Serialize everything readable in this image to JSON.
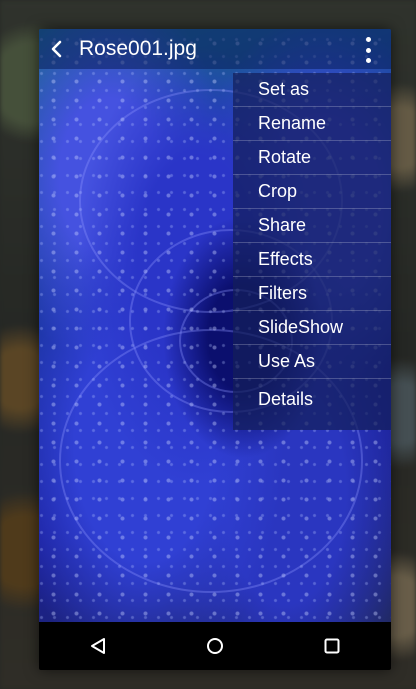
{
  "header": {
    "title": "Rose001.jpg",
    "back_icon": "chevron-left-icon",
    "menu_icon": "more-vertical-icon"
  },
  "menu": {
    "items": [
      {
        "label": "Set as"
      },
      {
        "label": "Rename"
      },
      {
        "label": "Rotate"
      },
      {
        "label": "Crop"
      },
      {
        "label": "Share"
      },
      {
        "label": "Effects"
      },
      {
        "label": "Filters"
      },
      {
        "label": "SlideShow"
      },
      {
        "label": "Use As"
      },
      {
        "label": "Details"
      }
    ]
  },
  "navbar": {
    "back_icon": "nav-back-icon",
    "home_icon": "nav-home-icon",
    "recents_icon": "nav-recents-icon"
  },
  "colors": {
    "photo_primary": "#2a35c8",
    "menu_bg": "#141e5a",
    "text": "#ffffff",
    "navbar_bg": "#000000"
  }
}
